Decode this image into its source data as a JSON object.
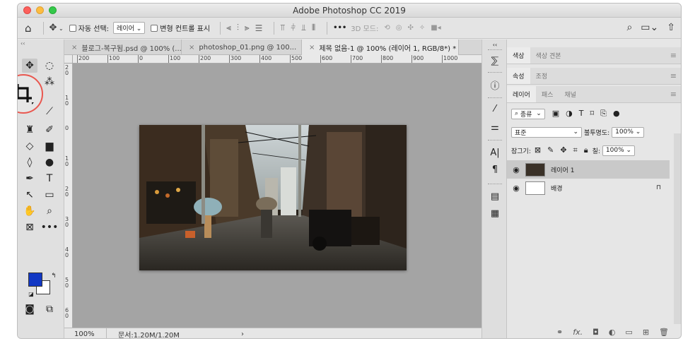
{
  "window": {
    "title": "Adobe Photoshop CC 2019"
  },
  "options_bar": {
    "auto_select_label": "자동 선택:",
    "auto_select_value": "레이어",
    "show_transform_label": "변형 컨트롤 표시",
    "more": "•••",
    "mode_3d": "3D 모드:"
  },
  "tabs": [
    {
      "label": "블로그-복구됨.psd @ 100% (..."
    },
    {
      "label": "photoshop_01.png @ 100..."
    },
    {
      "label": "제목 없음-1 @ 100% (레이어 1, RGB/8*) *"
    }
  ],
  "ruler_h": [
    "200",
    "100",
    "0",
    "100",
    "200",
    "300",
    "400",
    "500",
    "600",
    "700",
    "800",
    "900",
    "1000"
  ],
  "ruler_v": [
    "2 0",
    "1 0",
    "0",
    "1 0",
    "2 0",
    "3 0",
    "4 0",
    "5 0",
    "6 0"
  ],
  "status": {
    "zoom": "100%",
    "doc": "문서:1.20M/1.20M",
    "arrow": "›"
  },
  "colors": {
    "foreground": "#1238c4",
    "background": "#ffffff",
    "highlight": "#e9574f"
  },
  "panels": {
    "group1_tabs": [
      "색상",
      "색상 견본"
    ],
    "group2_tabs": [
      "속성",
      "조정"
    ],
    "group3_tabs": [
      "레이어",
      "패스",
      "채널"
    ],
    "filter_kind": "종류",
    "blend_mode": "표준",
    "opacity_label": "불투명도:",
    "opacity_value": "100%",
    "lock_label": "잠그기:",
    "fill_label": "칠:",
    "fill_value": "100%",
    "layers": [
      {
        "name": "레이어 1",
        "selected": true
      },
      {
        "name": "배경",
        "selected": false
      }
    ],
    "footer_fx": "fx."
  },
  "icons": {
    "home": "home-icon",
    "move": "move-icon",
    "crop": "crop-icon",
    "search": "search-icon",
    "share": "share-icon"
  }
}
